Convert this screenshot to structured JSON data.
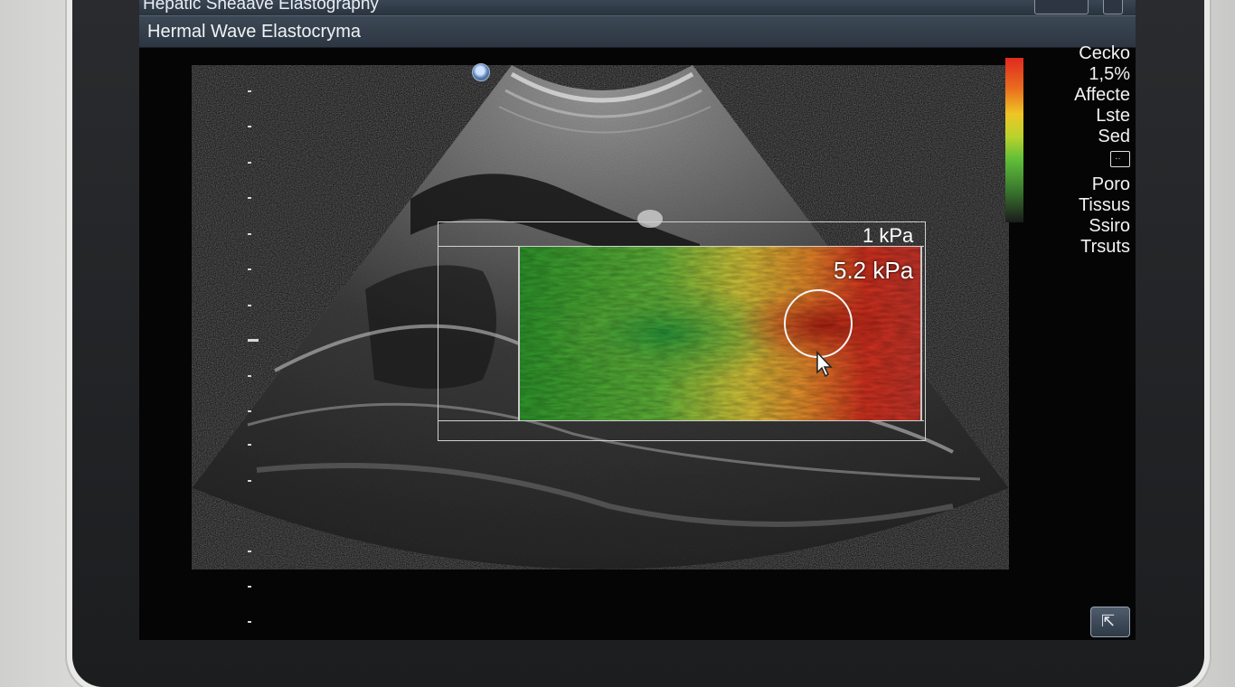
{
  "window": {
    "title": "Hepatic Sheaave Elastography"
  },
  "subheader": {
    "title": "Hermal Wave Elastocryma"
  },
  "legend": {
    "items_top": [
      "Cecko",
      "1,5%",
      "Affecte",
      "Lste",
      "Sed"
    ],
    "icon": "grid-icon",
    "items_bottom": [
      "Poro",
      "Tissus",
      "Ssiro",
      "Trsuts"
    ]
  },
  "roi": {
    "scale_label": "1 kPa",
    "measurement_value": "5.2 kPa"
  },
  "colors": {
    "colorbar_top": "#e02a1f",
    "colorbar_mid": "#efc525",
    "colorbar_low": "#5fbd38",
    "header_bg": "#2d3642"
  },
  "icons": {
    "probe_marker": "probe-orientation-icon",
    "cursor": "pointer-cursor-icon",
    "corner_button": "export-icon"
  }
}
